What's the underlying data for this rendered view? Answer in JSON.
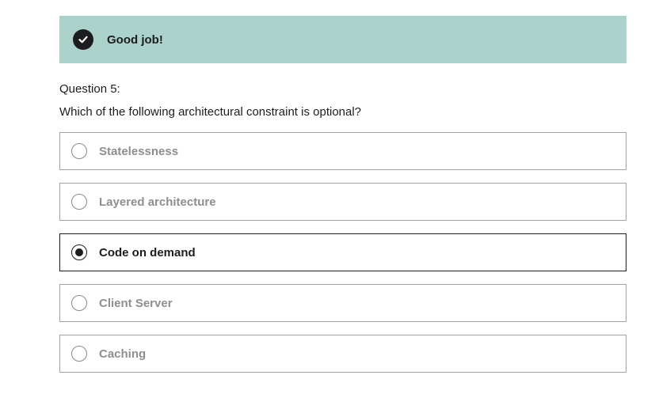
{
  "feedback": {
    "message": "Good job!",
    "icon": "check-circle-icon",
    "background_color": "#acd2cc"
  },
  "question": {
    "number_label": "Question 5:",
    "text": "Which of the following architectural constraint is optional?"
  },
  "options": [
    {
      "label": "Statelessness",
      "selected": false
    },
    {
      "label": "Layered architecture",
      "selected": false
    },
    {
      "label": "Code on demand",
      "selected": true
    },
    {
      "label": "Client Server",
      "selected": false
    },
    {
      "label": "Caching",
      "selected": false
    }
  ]
}
